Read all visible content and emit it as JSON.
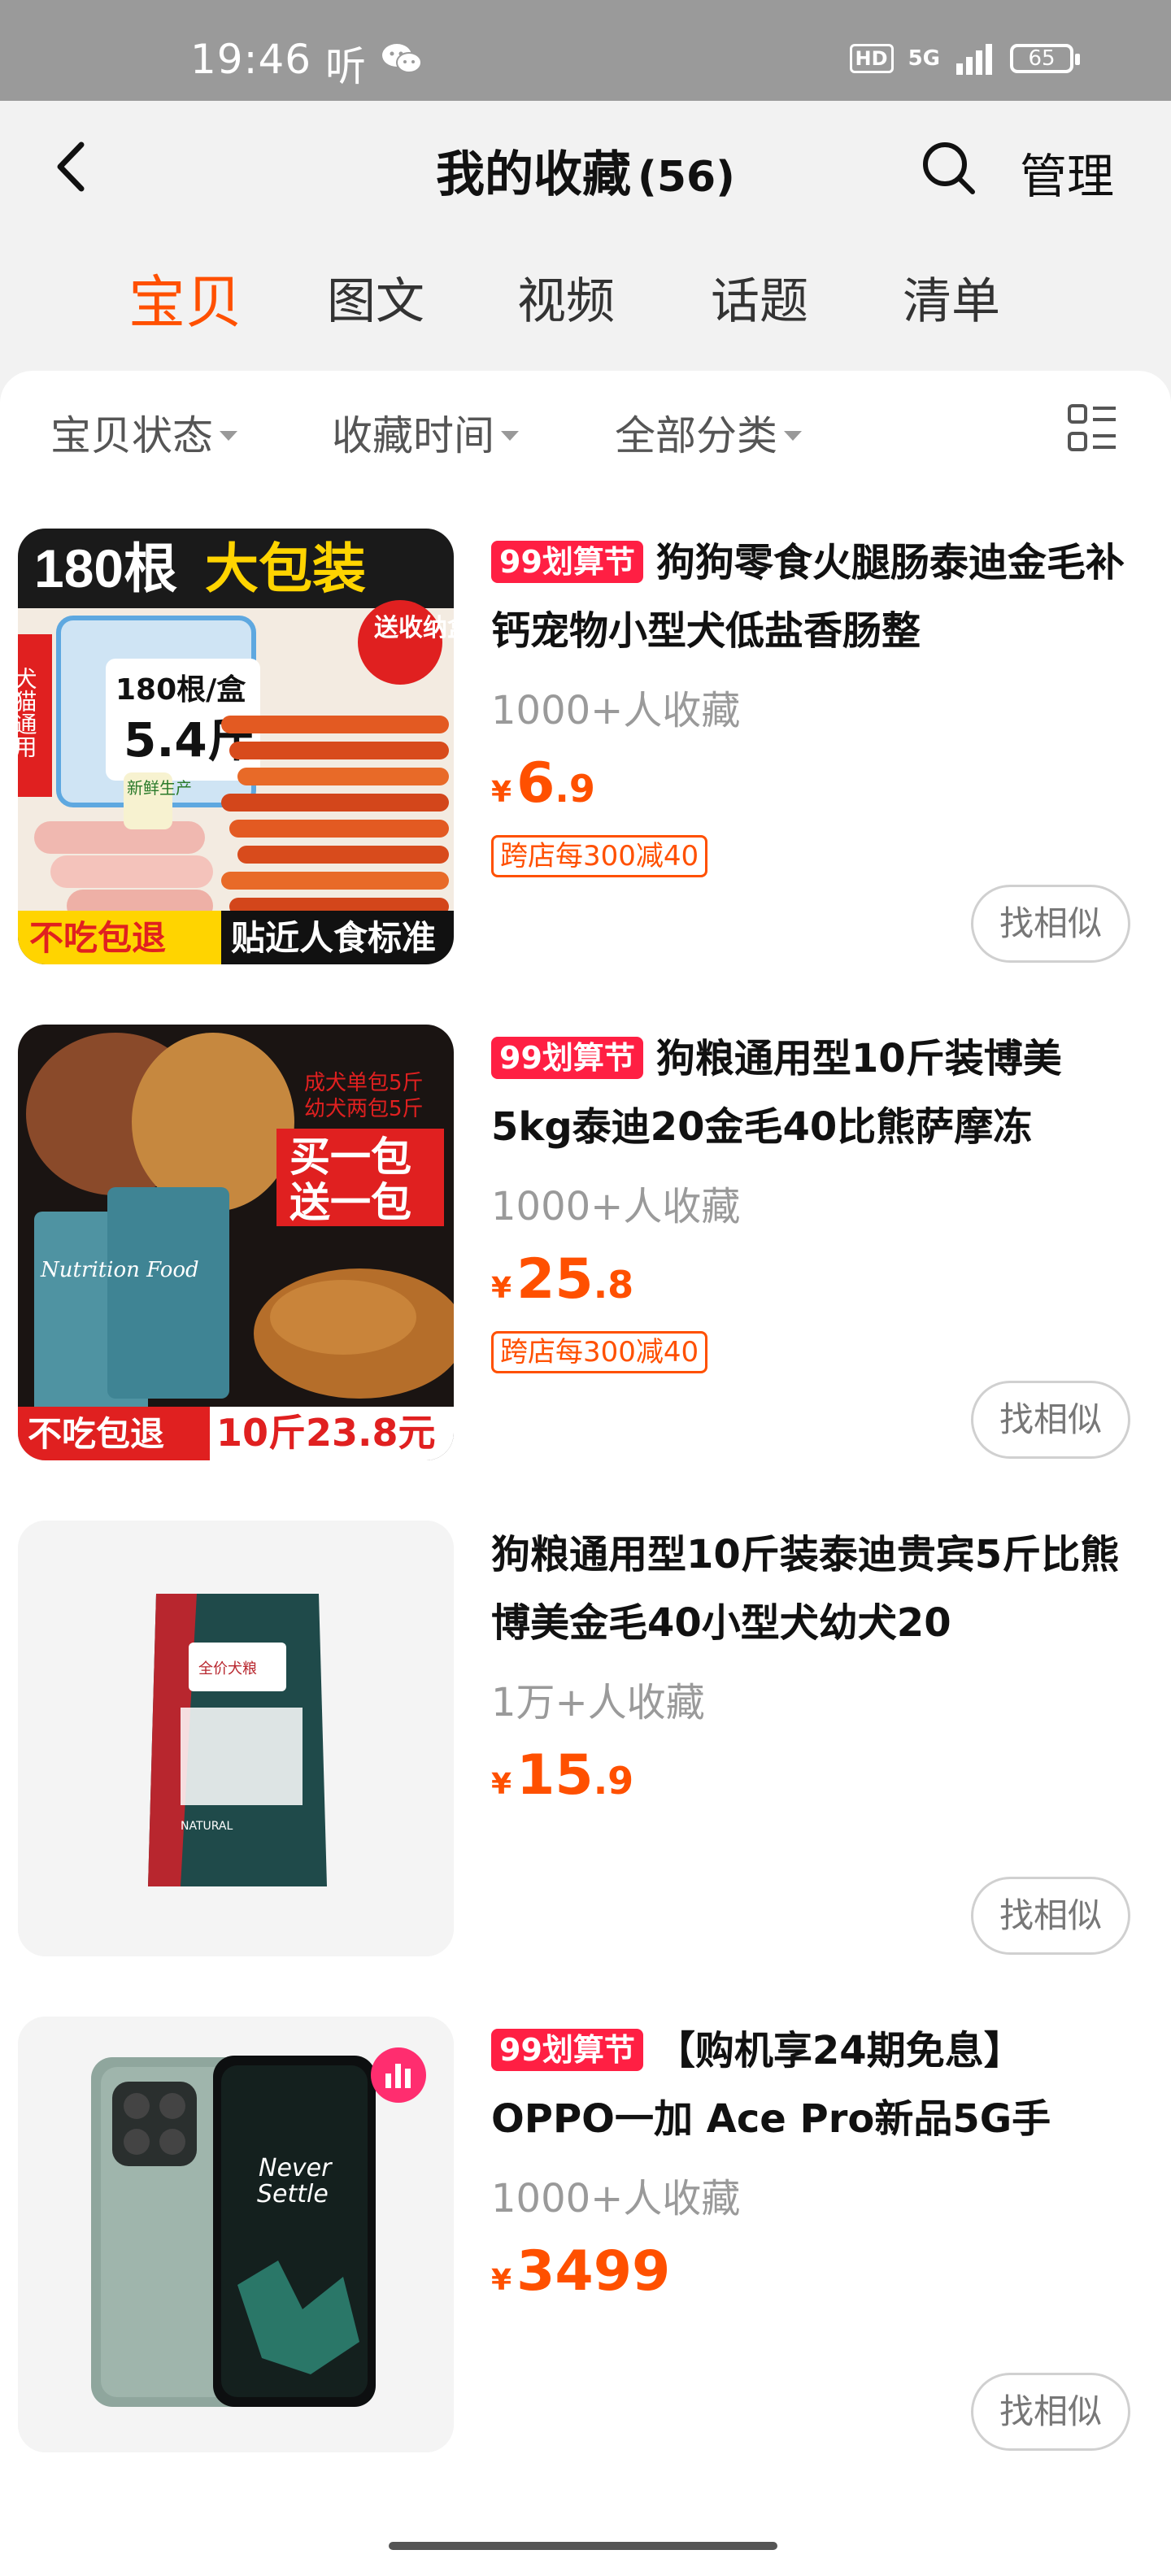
{
  "status_bar": {
    "time": "19:46",
    "listen": "听",
    "hd": "HD",
    "network": "5G",
    "battery": "65"
  },
  "header": {
    "title": "我的收藏",
    "count": "(56)",
    "manage_label": "管理"
  },
  "tabs": [
    "宝贝",
    "图文",
    "视频",
    "话题",
    "清单"
  ],
  "filters": [
    "宝贝状态",
    "收藏时间",
    "全部分类"
  ],
  "items": [
    {
      "tag": "99划算节",
      "title": "狗狗零食火腿肠泰迪金毛补钙宠物小型犬低盐香肠整",
      "favorites": "1000+人收藏",
      "price_symbol": "¥",
      "price_int": "6",
      "price_dec": ".9",
      "coupon": "跨店每300减40",
      "similar_label": "找相似",
      "image_text": {
        "headline_a": "180根",
        "headline_b": "大包装",
        "box_line1": "180根/盒",
        "box_line2": "5.4斤",
        "side": "犬猫通用",
        "badge": "送收纳盒",
        "fresh": "新鲜生产",
        "bottom_left": "不吃包退",
        "bottom_right": "贴近人食标准"
      }
    },
    {
      "tag": "99划算节",
      "title": "狗粮通用型10斤装博美5kg泰迪20金毛40比熊萨摩冻",
      "favorites": "1000+人收藏",
      "price_symbol": "¥",
      "price_int": "25",
      "price_dec": ".8",
      "coupon": "跨店每300减40",
      "similar_label": "找相似",
      "image_text": {
        "note1": "成犬单包5斤",
        "note2": "幼犬两包5斤",
        "promo1": "买一包",
        "promo2": "送一包",
        "bag_brand": "Nutrition Food",
        "bottom_left": "不吃包退",
        "bottom_right": "10斤23.8元"
      }
    },
    {
      "tag": "",
      "title": "狗粮通用型10斤装泰迪贵宾5斤比熊博美金毛40小型犬幼犬20",
      "favorites": "1万+人收藏",
      "price_symbol": "¥",
      "price_int": "15",
      "price_dec": ".9",
      "coupon": "",
      "similar_label": "找相似",
      "image_text": {
        "bag_label": "全价犬粮",
        "bag_bottom": "NATURAL"
      }
    },
    {
      "tag": "99划算节",
      "title": "【购机享24期免息】OPPO一加 Ace Pro新品5G手",
      "favorites": "1000+人收藏",
      "price_symbol": "¥",
      "price_int": "3499",
      "price_dec": "",
      "coupon": "",
      "similar_label": "找相似",
      "image_text": {
        "screen_line1": "Never",
        "screen_line2": "Settle"
      }
    }
  ]
}
